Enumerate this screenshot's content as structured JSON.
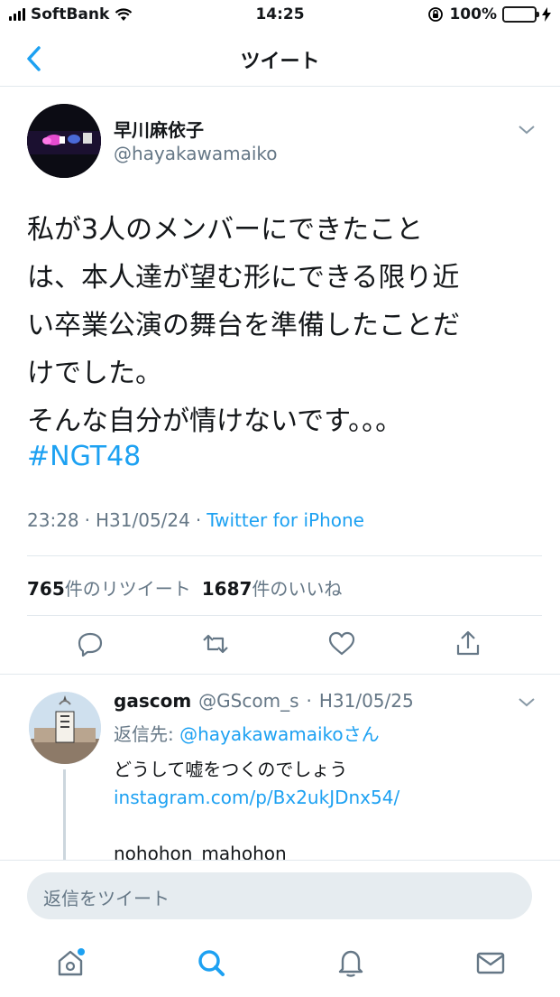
{
  "status_bar": {
    "carrier": "SoftBank",
    "time": "14:25",
    "battery": "100%",
    "battery_level": 1.0
  },
  "nav": {
    "title": "ツイート"
  },
  "tweet": {
    "display_name": "早川麻依子",
    "handle": "@hayakawamaiko",
    "text": "私が3人のメンバーにできたこと\nは、本人達が望む形にできる限り近\nい卒業公演の舞台を準備したことだ\nけでした。\nそんな自分が情けないです。。。",
    "hashtag": "#NGT48",
    "time": "23:28",
    "sep1": "·",
    "date": "H31/05/24",
    "sep2": "·",
    "client": "Twitter for iPhone",
    "retweet_count": "765",
    "retweet_label": "件のリツイート",
    "like_count": "1687",
    "like_label": "件のいいね"
  },
  "reply": {
    "display_name": "gascom",
    "handle": "@GScom_s",
    "sep": "·",
    "date": "H31/05/25",
    "reply_to_prefix": "返信先: ",
    "reply_to_handle": "@hayakawamaikoさん",
    "line1": "どうして嘘をつくのでしょう",
    "link": "instagram.com/p/Bx2ukJDnx54/",
    "line3": "nohohon_mahohon"
  },
  "compose": {
    "placeholder": "返信をツイート"
  },
  "colors": {
    "accent": "#1da1f2",
    "muted": "#657786",
    "battery_fill": "#4cd964",
    "notification_dot": "#1da1f2"
  },
  "icons": {
    "back": "chevron-left-icon",
    "caret": "chevron-down-icon",
    "reply": "reply-bubble-icon",
    "retweet": "retweet-icon",
    "like": "heart-icon",
    "share": "share-icon",
    "home": "home-icon",
    "search": "search-icon",
    "notifications": "bell-icon",
    "messages": "envelope-icon"
  }
}
